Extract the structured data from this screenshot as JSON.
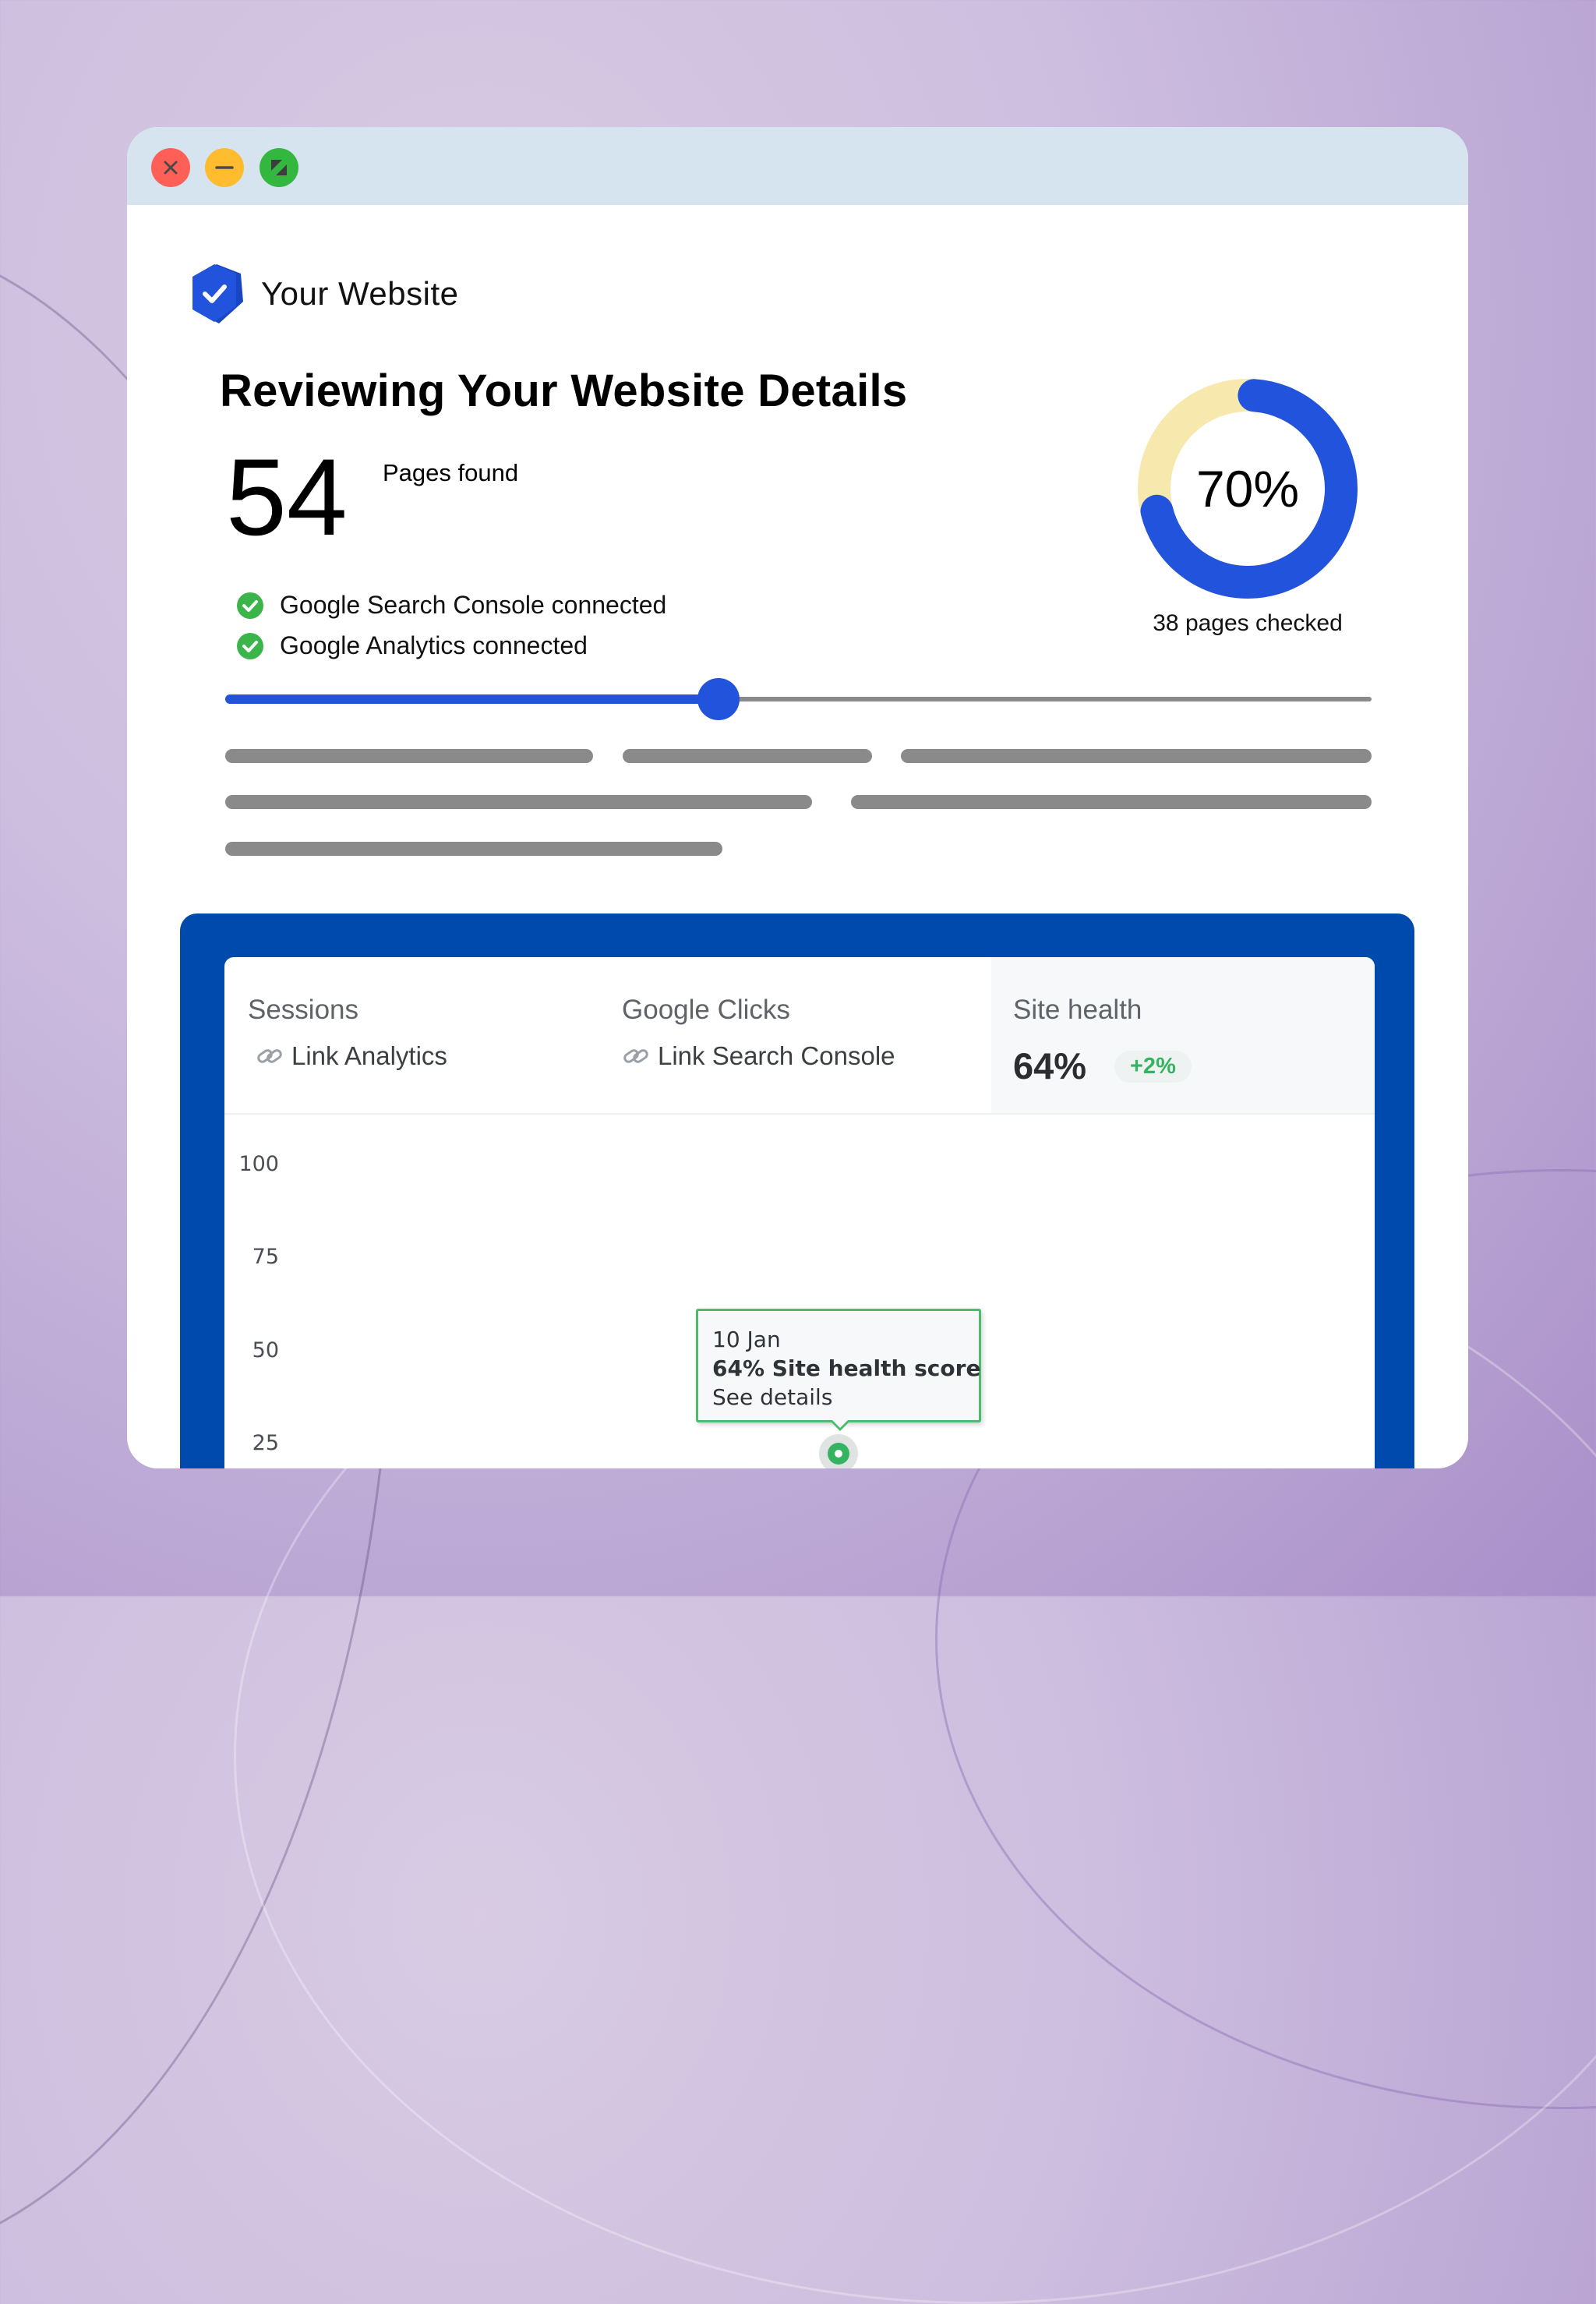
{
  "window": {
    "controls": [
      {
        "name": "close",
        "icon": "close-icon",
        "color": "#fe5f57"
      },
      {
        "name": "minimize",
        "icon": "minimize-icon",
        "color": "#febc2e"
      },
      {
        "name": "maximize",
        "icon": "maximize-icon",
        "color": "#33b73f"
      }
    ]
  },
  "brand": {
    "name": "Your Website",
    "logo_icon": "shield-check-icon",
    "color": "#2253dc"
  },
  "page": {
    "title": "Reviewing Your Website Details"
  },
  "summary": {
    "pages_found_value": "54",
    "pages_found_label": "Pages found",
    "connections": [
      {
        "label": "Google Search Console connected",
        "icon": "check-circle-icon",
        "status": "connected"
      },
      {
        "label": "Google Analytics connected",
        "icon": "check-circle-icon",
        "status": "connected"
      }
    ]
  },
  "progress_ring": {
    "value_label": "70%",
    "percent": 70,
    "caption": "38 pages checked",
    "fill_color": "#2253dc",
    "track_color": "#f7e9ad"
  },
  "progress_slider": {
    "percent": 43,
    "fill_color": "#2253dc",
    "track_color": "#8a8a8a"
  },
  "dashboard": {
    "panel_color": "#004aad",
    "metrics": [
      {
        "title": "Sessions",
        "link_label": "Link Analytics",
        "link_icon": "link-icon"
      },
      {
        "title": "Google Clicks",
        "link_label": "Link Search Console",
        "link_icon": "link-icon"
      },
      {
        "title": "Site health",
        "value": "64%",
        "delta": "+2%"
      }
    ],
    "chart": {
      "y_ticks": [
        "100",
        "75",
        "50",
        "25"
      ],
      "tooltip": {
        "date": "10 Jan",
        "score_line": "64% Site health score",
        "link": "See details"
      },
      "highlight_point": {
        "date": "10 Jan",
        "value": 64
      },
      "accent_color": "#34b460"
    }
  }
}
